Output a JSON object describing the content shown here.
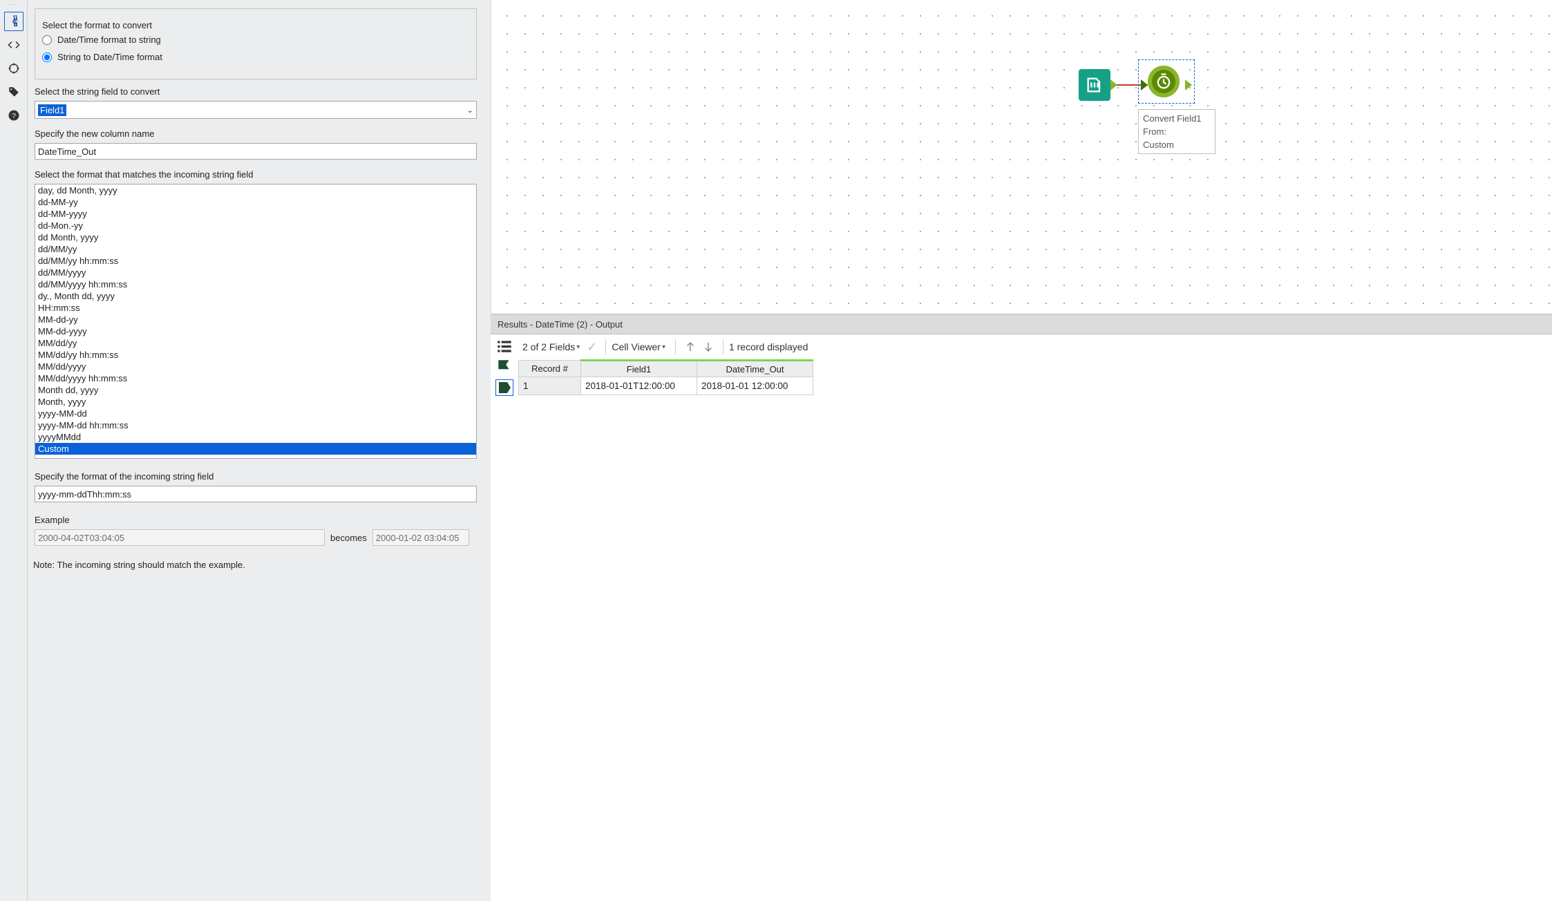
{
  "config": {
    "select_format_label": "Select the format to convert",
    "radio_dt_to_str": "Date/Time format to string",
    "radio_str_to_dt": "String to Date/Time format",
    "selected_radio": "str_to_dt",
    "field_label": "Select the string field to convert",
    "field_value": "Field1",
    "newcol_label": "Specify the new column name",
    "newcol_value": "DateTime_Out",
    "formats_label": "Select the format that matches the incoming string field",
    "formats": [
      "day, dd Month, yyyy",
      "dd-MM-yy",
      "dd-MM-yyyy",
      "dd-Mon.-yy",
      "dd Month, yyyy",
      "dd/MM/yy",
      "dd/MM/yy hh:mm:ss",
      "dd/MM/yyyy",
      "dd/MM/yyyy hh:mm:ss",
      "dy., Month dd, yyyy",
      "HH:mm:ss",
      "MM-dd-yy",
      "MM-dd-yyyy",
      "MM/dd/yy",
      "MM/dd/yy hh:mm:ss",
      "MM/dd/yyyy",
      "MM/dd/yyyy hh:mm:ss",
      "Month dd, yyyy",
      "Month, yyyy",
      "yyyy-MM-dd",
      "yyyy-MM-dd hh:mm:ss",
      "yyyyMMdd",
      "Custom"
    ],
    "formats_selected_index": 22,
    "custom_label": "Specify the format of the incoming string field",
    "custom_value": "yyyy-mm-ddThh:mm:ss",
    "example_label": "Example",
    "example_in": "2000-04-02T03:04:05",
    "becomes": "becomes",
    "example_out": "2000-01-02 03:04:05",
    "note": "Note: The incoming string should match the example."
  },
  "canvas": {
    "node_label_line1": "Convert Field1",
    "node_label_line2": "From:",
    "node_label_line3": "Custom"
  },
  "results": {
    "header": "Results - DateTime (2) - Output",
    "fields_summary": "2 of 2 Fields",
    "cell_viewer": "Cell Viewer",
    "records_summary": "1 record displayed",
    "columns": [
      "Record #",
      "Field1",
      "DateTime_Out"
    ],
    "rows": [
      {
        "record": "1",
        "Field1": "2018-01-01T12:00:00",
        "DateTime_Out": "2018-01-01 12:00:00"
      }
    ]
  }
}
